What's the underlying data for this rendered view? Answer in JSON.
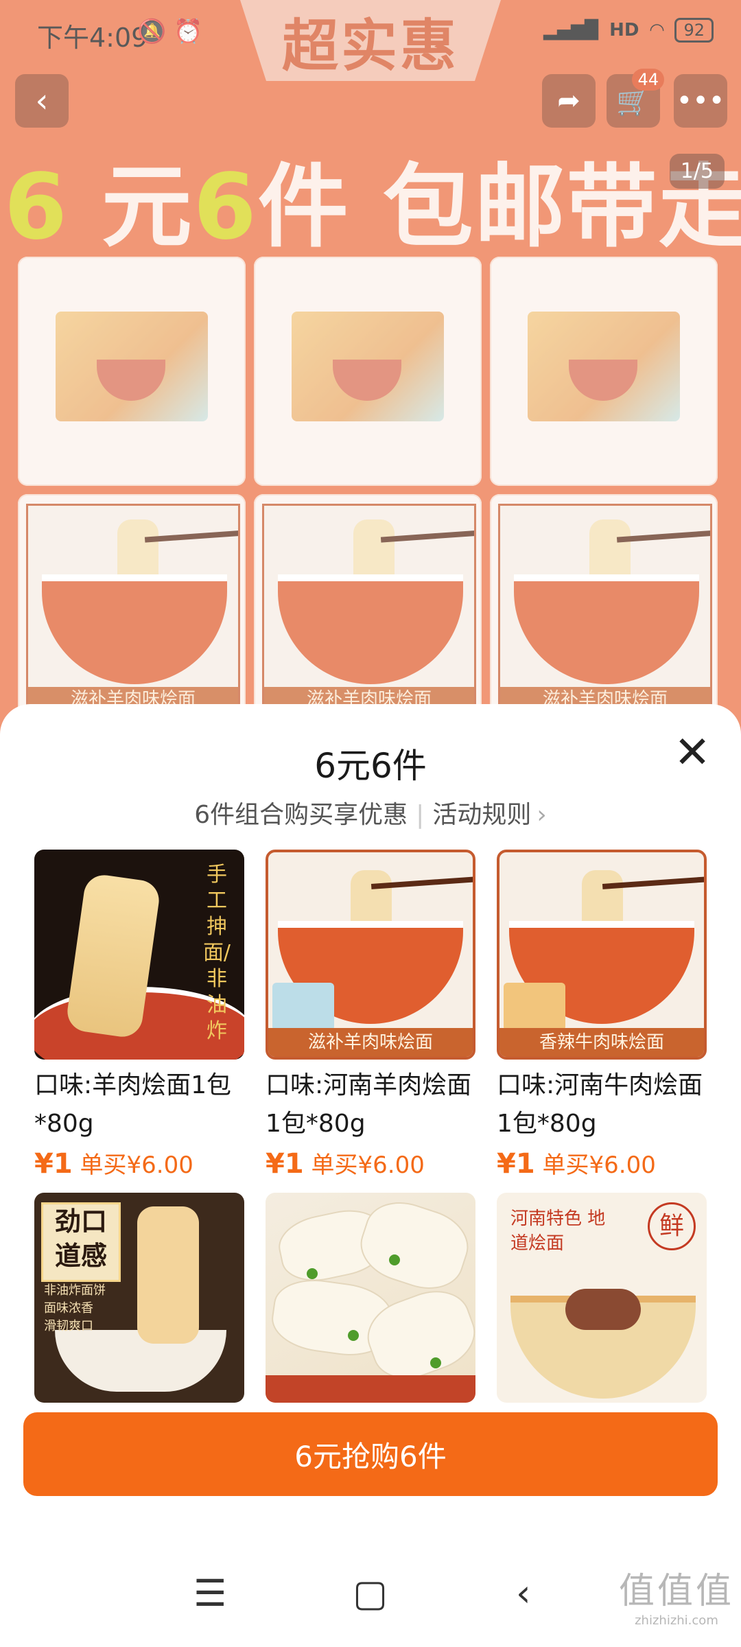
{
  "status_bar": {
    "time": "下午4:09",
    "icons": "🔕 ⏰",
    "signal": "HD",
    "battery": "92"
  },
  "background_page": {
    "banner": "超实惠",
    "cart_count": "44",
    "headline_digit1": "6",
    "headline_mid": " 元",
    "headline_digit2": "6",
    "headline_rest": "件 包邮带走",
    "pager": "1/5",
    "tile_labels": [
      "滋补羊肉味烩面",
      "滋补羊肉味烩面",
      "滋补羊肉味烩面"
    ]
  },
  "sheet": {
    "title": "6元6件",
    "subtitle": "6件组合购买享优惠",
    "rules_link": "活动规则",
    "products": [
      {
        "desc": "口味:羊肉烩面1包*80g",
        "price_symbol": "¥",
        "price": "1",
        "single": "单买¥6.00",
        "image_text": "手工抻面/非油炸"
      },
      {
        "desc": "口味:河南羊肉烩面1包*80g",
        "price_symbol": "¥",
        "price": "1",
        "single": "单买¥6.00",
        "image_text": "滋补羊肉味烩面"
      },
      {
        "desc": "口味:河南牛肉烩面1包*80g",
        "price_symbol": "¥",
        "price": "1",
        "single": "单买¥6.00",
        "image_text": "香辣牛肉味烩面"
      }
    ],
    "second_row": {
      "p4_title": "劲口道感",
      "p4_list": [
        "非油炸面饼",
        "面味浓香",
        "滑韧爽口"
      ],
      "p6_title": "河南特色 地道烩面",
      "p6_seal": "鲜"
    },
    "buy_button": "6元抢购6件"
  },
  "watermark": {
    "line1": "值值值",
    "line2": "zhizhizhi.com"
  },
  "colors": {
    "accent": "#f46a17",
    "banner_bg": "#ec7042"
  }
}
